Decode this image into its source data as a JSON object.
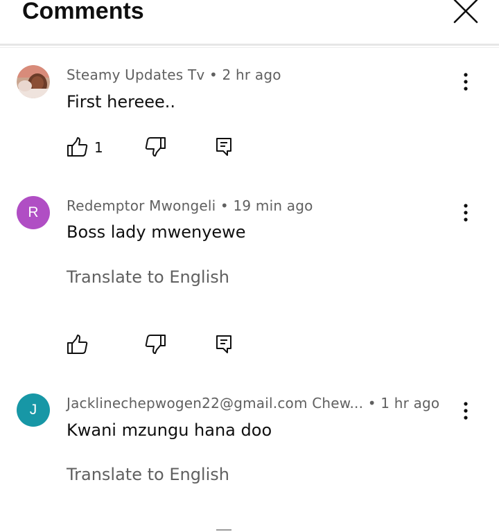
{
  "header": {
    "title": "Comments",
    "close_icon": "close-icon"
  },
  "colors": {
    "avatar_r": "#b04ec4",
    "avatar_j": "#1797a6",
    "secondary_text": "#606060",
    "primary_text": "#0f0f0f"
  },
  "comments": [
    {
      "author": "Steamy Updates Tv",
      "time": "2 hr ago",
      "meta": "Steamy Updates Tv • 2 hr ago",
      "text": "First hereee..",
      "likes": "1",
      "avatar_type": "photo"
    },
    {
      "author": "Redemptor Mwongeli",
      "time": "19 min ago",
      "meta": "Redemptor Mwongeli • 19 min ago",
      "text": "Boss lady mwenyewe",
      "translate": "Translate to English",
      "avatar_letter": "R"
    },
    {
      "author": "Jacklinechepwogen22@gmail.com Chew...",
      "time": "1 hr ago",
      "meta": "Jacklinechepwogen22@gmail.com Chew... • 1 hr ago",
      "text": "Kwani mzungu hana doo",
      "translate": "Translate to English",
      "avatar_letter": "J"
    }
  ],
  "icons": {
    "like": "thumbs-up-icon",
    "dislike": "thumbs-down-icon",
    "reply": "reply-icon",
    "more": "more-vert-icon"
  }
}
